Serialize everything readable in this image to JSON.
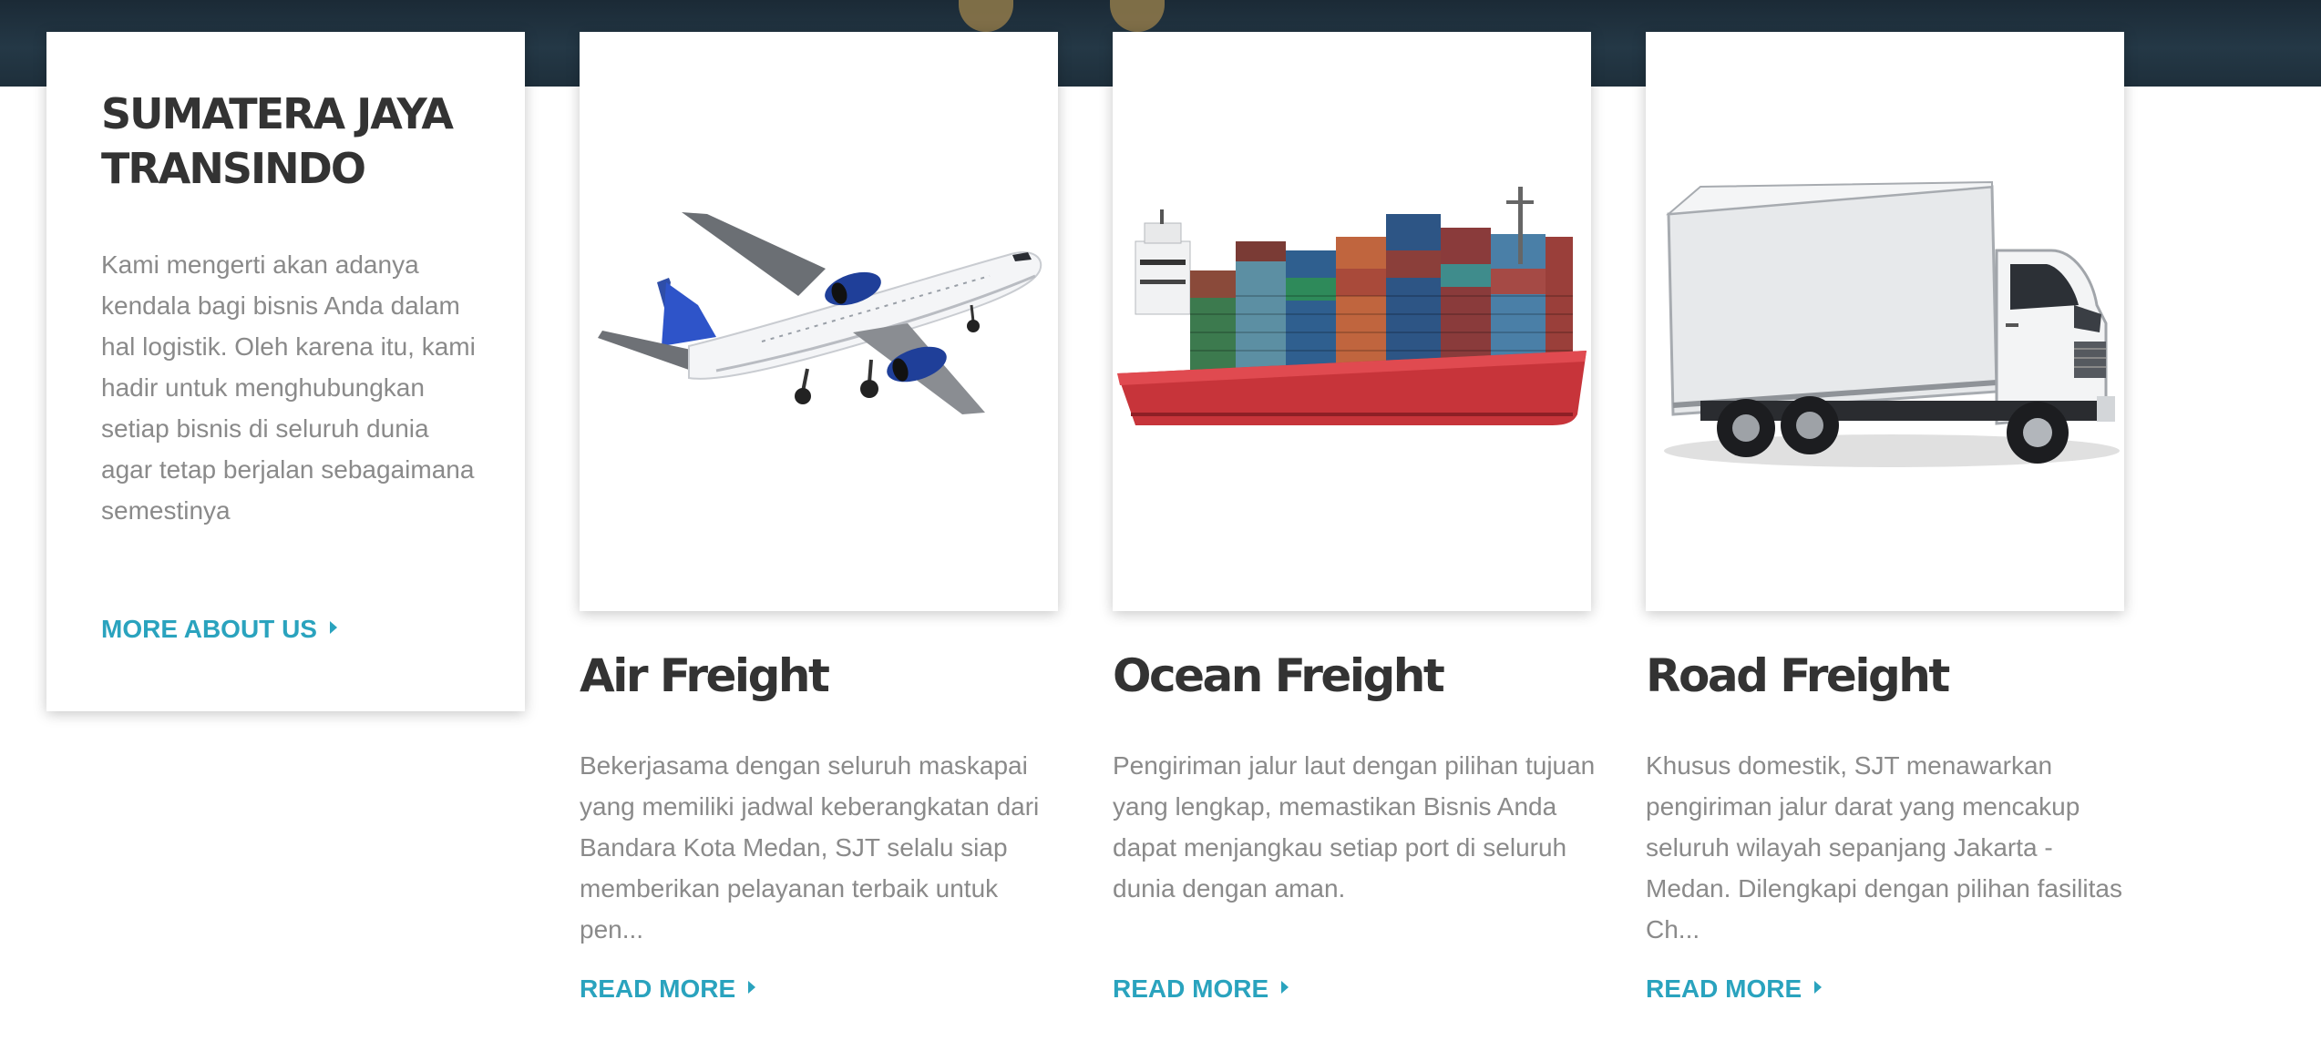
{
  "about": {
    "title": "SUMATERA JAYA TRANSINDO",
    "text": "Kami mengerti akan adanya kendala bagi bisnis Anda dalam hal logistik. Oleh karena itu, kami hadir untuk menghubungkan setiap bisnis di seluruh dunia agar tetap berjalan sebagaimana semestinya",
    "link": "MORE ABOUT US"
  },
  "services": [
    {
      "title": "Air Freight",
      "text": "Bekerjasama dengan seluruh maskapai yang memiliki jadwal keberangkatan dari Bandara Kota Medan, SJT selalu siap memberikan pelayanan terbaik untuk pen...",
      "link": "READ MORE",
      "image": "airplane"
    },
    {
      "title": "Ocean Freight",
      "text": "Pengiriman jalur laut dengan pilihan tujuan yang lengkap, memastikan Bisnis Anda dapat menjangkau setiap port di seluruh dunia dengan aman.",
      "link": "READ MORE",
      "image": "container-ship"
    },
    {
      "title": "Road Freight",
      "text": "Khusus domestik, SJT menawarkan pengiriman jalur darat yang mencakup seluruh wilayah sepanjang Jakarta - Medan. Dilengkapi dengan pilihan fasilitas Ch...",
      "link": "READ MORE",
      "image": "box-truck"
    }
  ],
  "colors": {
    "accent": "#2aa3be",
    "heading": "#333333",
    "body_text": "#8a8a8a",
    "hero_background": "#1e2f3b"
  }
}
